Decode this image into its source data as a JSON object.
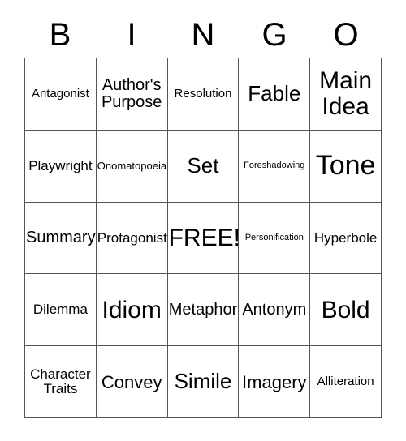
{
  "card": {
    "title": "BINGO",
    "header_letters": [
      "B",
      "I",
      "N",
      "G",
      "O"
    ],
    "columns": 5,
    "rows": 5,
    "free_space_label": "FREE!",
    "colors": {
      "background": "#ffffff",
      "text": "#000000",
      "grid_line": "#555555"
    },
    "cells": [
      {
        "text": "Antagonist",
        "size": "fs-md"
      },
      {
        "text": "Author's\nPurpose",
        "size": "fs-xl"
      },
      {
        "text": "Resolution",
        "size": "fs-md"
      },
      {
        "text": "Fable",
        "size": "fs-3xl"
      },
      {
        "text": "Main\nIdea",
        "size": "fs-4xl"
      },
      {
        "text": "Playwright",
        "size": "fs-lg"
      },
      {
        "text": "Onomatopoeia",
        "size": "fs-sm"
      },
      {
        "text": "Set",
        "size": "fs-3xl"
      },
      {
        "text": "Foreshadowing",
        "size": "fs-xs"
      },
      {
        "text": "Tone",
        "size": "fs-5xl"
      },
      {
        "text": "Summary",
        "size": "fs-xl"
      },
      {
        "text": "Protagonist",
        "size": "fs-lg"
      },
      {
        "text": "FREE!",
        "size": "fs-4xl"
      },
      {
        "text": "Personification",
        "size": "fs-xs"
      },
      {
        "text": "Hyperbole",
        "size": "fs-lg"
      },
      {
        "text": "Dilemma",
        "size": "fs-lg"
      },
      {
        "text": "Idiom",
        "size": "fs-4xl"
      },
      {
        "text": "Metaphor",
        "size": "fs-xl"
      },
      {
        "text": "Antonym",
        "size": "fs-xl"
      },
      {
        "text": "Bold",
        "size": "fs-4xl"
      },
      {
        "text": "Character\nTraits",
        "size": "fs-lg"
      },
      {
        "text": "Convey",
        "size": "fs-2xl"
      },
      {
        "text": "Simile",
        "size": "fs-3xl"
      },
      {
        "text": "Imagery",
        "size": "fs-2xl"
      },
      {
        "text": "Alliteration",
        "size": "fs-md"
      }
    ]
  }
}
